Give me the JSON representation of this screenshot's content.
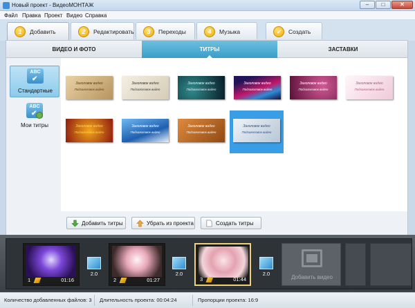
{
  "window": {
    "title": "Новый проект - ВидеоМОНТАЖ",
    "min": "–",
    "max": "□",
    "close": "✕"
  },
  "menu": [
    "Файл",
    "Правка",
    "Проект",
    "Видео",
    "Справка"
  ],
  "steps": [
    {
      "num": "1",
      "label": "Добавить",
      "active": true
    },
    {
      "num": "2",
      "label": "Редактировать",
      "active": false
    },
    {
      "num": "3",
      "label": "Переходы",
      "active": false
    },
    {
      "num": "4",
      "label": "Музыка",
      "active": false
    },
    {
      "num": "",
      "label": "Создать",
      "active": false
    }
  ],
  "subtabs": [
    {
      "label": "ВИДЕО И ФОТО",
      "active": false
    },
    {
      "label": "ТИТРЫ",
      "active": true
    },
    {
      "label": "ЗАСТАВКИ",
      "active": false
    }
  ],
  "categories": [
    {
      "icon_text": "ABC",
      "label": "Стандартные",
      "active": true
    },
    {
      "icon_text": "ABC",
      "label": "Мои титры",
      "active": false
    }
  ],
  "templates": [
    {
      "title": "Заголовок видео",
      "subtitle": "Подзаголовок видео",
      "bg": "#d9c39a",
      "fg": "#5a3b12",
      "selected": false
    },
    {
      "title": "Заголовок видео",
      "subtitle": "Подзаголовок видео",
      "bg": "#e8e1d3",
      "fg": "#333333",
      "selected": false
    },
    {
      "title": "Заголовок видео",
      "subtitle": "Подзаголовок видео",
      "bg": "#0f2a3a",
      "fg": "#e9f3ff",
      "selected": false
    },
    {
      "title": "Заголовок видео",
      "subtitle": "Подзаголовок видео",
      "bg": "#2a1c5e",
      "fg": "#ffffff",
      "selected": false
    },
    {
      "title": "Заголовок видео",
      "subtitle": "Подзаголовок видео",
      "bg": "#7d1a4e",
      "fg": "#ffffff",
      "selected": false
    },
    {
      "title": "Заголовок видео",
      "subtitle": "Подзаголовок видео",
      "bg": "#f8e6ee",
      "fg": "#b0577d",
      "selected": false
    },
    {
      "title": "Заголовок видео",
      "subtitle": "Подзаголовок видео",
      "bg": "#b32418",
      "fg": "#ffd84a",
      "selected": false
    },
    {
      "title": "Заголовок видео",
      "subtitle": "Подзаголовок видео",
      "bg": "#2f7fd0",
      "fg": "#ffffff",
      "selected": false
    },
    {
      "title": "Заголовок видео",
      "subtitle": "Подзаголовок видео",
      "bg": "#c46a22",
      "fg": "#ffffff",
      "selected": false
    },
    {
      "title": "Заголовок видео",
      "subtitle": "Подзаголовок видео",
      "bg": "#cfd9e3",
      "fg": "#2d4f8a",
      "selected": true
    }
  ],
  "actions": {
    "add": "Добавить титры",
    "remove": "Убрать из проекта",
    "create": "Создать титры"
  },
  "timeline": {
    "clips": [
      {
        "index": "1",
        "duration": "01:16",
        "selected": false
      },
      {
        "index": "2",
        "duration": "01:27",
        "selected": false
      },
      {
        "index": "3",
        "duration": "01:44",
        "selected": true
      }
    ],
    "transitions": [
      "2.0",
      "2.0",
      "2.0"
    ],
    "add_video": "Добавить видео"
  },
  "status": {
    "files": "Количество добавленных файлов: 3",
    "duration": "Длительность проекта: 00:04:24",
    "aspect": "Пропорции проекта: 16:9"
  }
}
